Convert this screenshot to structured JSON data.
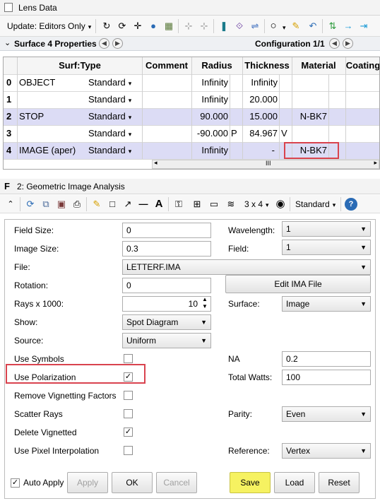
{
  "lens_data": {
    "title": "Lens Data",
    "update_label": "Update: Editors Only",
    "surface_props": "Surface 4 Properties",
    "configuration": "Configuration 1/1",
    "columns": [
      "Surf:Type",
      "Comment",
      "Radius",
      "Thickness",
      "Material",
      "Coating"
    ],
    "rows": [
      {
        "num": "0",
        "name": "OBJECT",
        "type": "Standard",
        "radius": "Infinity",
        "rflag": "",
        "thickness": "Infinity",
        "tflag": "",
        "material": ""
      },
      {
        "num": "1",
        "name": "",
        "type": "Standard",
        "radius": "Infinity",
        "rflag": "",
        "thickness": "20.000",
        "tflag": "",
        "material": ""
      },
      {
        "num": "2",
        "name": "STOP",
        "type": "Standard",
        "radius": "90.000",
        "rflag": "",
        "thickness": "15.000",
        "tflag": "",
        "material": "N-BK7"
      },
      {
        "num": "3",
        "name": "",
        "type": "Standard",
        "radius": "-90.000",
        "rflag": "P",
        "thickness": "84.967",
        "tflag": "V",
        "material": ""
      },
      {
        "num": "4",
        "name": "IMAGE (aper)",
        "type": "Standard",
        "radius": "Infinity",
        "rflag": "",
        "thickness": "-",
        "tflag": "",
        "material": "N-BK7"
      }
    ],
    "scroll_grip": "III"
  },
  "analysis": {
    "title": "2: Geometric Image Analysis",
    "grid_label": "3 x 4",
    "standard_label": "Standard",
    "field_size": {
      "label": "Field Size:",
      "value": "0"
    },
    "image_size": {
      "label": "Image Size:",
      "value": "0.3"
    },
    "file": {
      "label": "File:",
      "value": "LETTERF.IMA"
    },
    "rotation": {
      "label": "Rotation:",
      "value": "0"
    },
    "rays": {
      "label": "Rays x 1000:",
      "value": "10"
    },
    "show": {
      "label": "Show:",
      "value": "Spot Diagram"
    },
    "source": {
      "label": "Source:",
      "value": "Uniform"
    },
    "use_symbols": {
      "label": "Use Symbols",
      "checked": false
    },
    "use_polarization": {
      "label": "Use Polarization",
      "checked": true
    },
    "remove_vignetting": {
      "label": "Remove Vignetting Factors",
      "checked": false
    },
    "scatter_rays": {
      "label": "Scatter Rays",
      "checked": false
    },
    "delete_vignetted": {
      "label": "Delete Vignetted",
      "checked": true
    },
    "pixel_interp": {
      "label": "Use Pixel Interpolation",
      "checked": false
    },
    "wavelength": {
      "label": "Wavelength:",
      "value": "1"
    },
    "field": {
      "label": "Field:",
      "value": "1"
    },
    "edit_ima": "Edit IMA File",
    "surface": {
      "label": "Surface:",
      "value": "Image"
    },
    "na": {
      "label": "NA",
      "value": "0.2"
    },
    "total_watts": {
      "label": "Total Watts:",
      "value": "100"
    },
    "parity": {
      "label": "Parity:",
      "value": "Even"
    },
    "reference": {
      "label": "Reference:",
      "value": "Vertex"
    },
    "auto_apply": {
      "label": "Auto Apply",
      "checked": true
    },
    "buttons": {
      "apply": "Apply",
      "ok": "OK",
      "cancel": "Cancel",
      "save": "Save",
      "load": "Load",
      "reset": "Reset"
    }
  },
  "colors": {
    "highlight": "#d9434e",
    "selected_row": "#dcdcf5",
    "save": "#f6f261"
  }
}
